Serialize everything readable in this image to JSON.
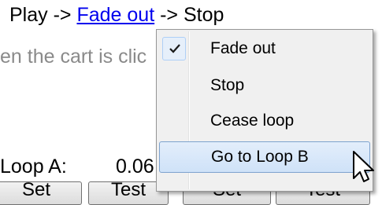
{
  "cycle": {
    "play": "Play ->",
    "fade_out_link": "Fade out",
    "stop": "-> Stop"
  },
  "hint_text": "en the cart is clic",
  "loop": {
    "label": "Loop A:",
    "value": "0.06"
  },
  "buttons": [
    "Set",
    "Test",
    "Set",
    "Test"
  ],
  "context_menu": {
    "items": [
      {
        "label": "Fade out",
        "checked": true
      },
      {
        "label": "Stop",
        "checked": false
      },
      {
        "label": "Cease loop",
        "checked": false
      },
      {
        "label": "Go to Loop B",
        "checked": false,
        "highlighted": true
      }
    ]
  },
  "colors": {
    "link": "#0000ee",
    "menu_background": "#f0f0f0",
    "highlight_border": "#7da2ce",
    "hint_text": "#8a8a8a"
  },
  "icons": {
    "check": "check-icon",
    "cursor": "mouse-pointer-icon"
  }
}
